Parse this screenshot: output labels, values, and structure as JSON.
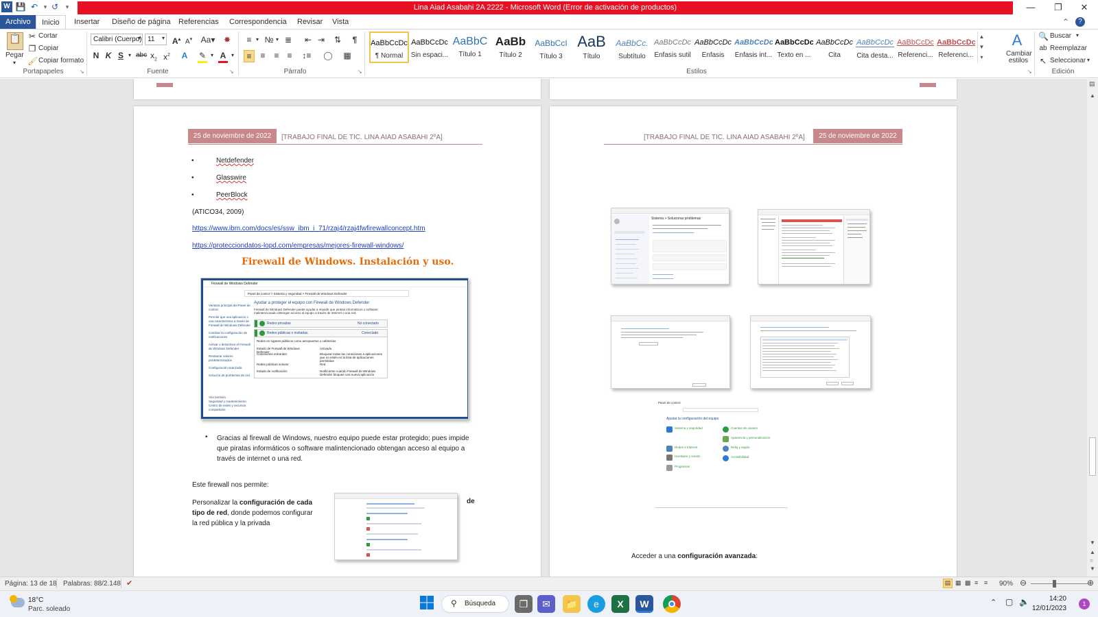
{
  "window": {
    "title": "Lina Aiad Asabahi 2A 2222  -  Microsoft Word (Error de activación de productos)"
  },
  "tabs": [
    "Archivo",
    "Inicio",
    "Insertar",
    "Diseño de página",
    "Referencias",
    "Correspondencia",
    "Revisar",
    "Vista"
  ],
  "ribbon": {
    "clipboard": {
      "paste": "Pegar",
      "cut": "Cortar",
      "copy": "Copiar",
      "format_painter": "Copiar formato",
      "group": "Portapapeles"
    },
    "font": {
      "name": "Calibri (Cuerpo)",
      "size": "11",
      "group": "Fuente"
    },
    "paragraph": {
      "group": "Párrafo"
    },
    "styles": {
      "group": "Estilos",
      "change_styles": "Cambiar estilos",
      "items": [
        {
          "sample": "AaBbCcDc",
          "name": "¶ Normal"
        },
        {
          "sample": "AaBbCcDc",
          "name": "Sin espaci..."
        },
        {
          "sample": "AaBbC",
          "name": "Título 1"
        },
        {
          "sample": "AaBb",
          "name": "Título 2"
        },
        {
          "sample": "AaBbCcI",
          "name": "Título 3"
        },
        {
          "sample": "AaB",
          "name": "Título"
        },
        {
          "sample": "AaBbCc.",
          "name": "Subtítulo"
        },
        {
          "sample": "AaBbCcDc",
          "name": "Énfasis sutil"
        },
        {
          "sample": "AaBbCcDc",
          "name": "Énfasis"
        },
        {
          "sample": "AaBbCcDc",
          "name": "Énfasis int..."
        },
        {
          "sample": "AaBbCcDc",
          "name": "Texto en ..."
        },
        {
          "sample": "AaBbCcDc",
          "name": "Cita"
        },
        {
          "sample": "AaBbCcDc",
          "name": "Cita desta..."
        },
        {
          "sample": "AaBbCcDc",
          "name": "Referenci..."
        },
        {
          "sample": "AaBbCcDc",
          "name": "Referenci..."
        }
      ]
    },
    "editing": {
      "find": "Buscar",
      "replace": "Reemplazar",
      "select": "Seleccionar",
      "group": "Edición"
    }
  },
  "left_page": {
    "header_date": "25 de noviembre de 2022",
    "header_title": "[TRABAJO FINAL DE TIC. LINA AIAD ASABAHI 2ºA]",
    "bullets": [
      "Netdefender",
      "Glasswire",
      "PeerBlock"
    ],
    "citation": "(ATICO34, 2009)",
    "link1": "https://www.ibm.com/docs/es/ssw_ibm_i_71/rzaj4/rzaj4fwfirewallconcept.htm",
    "link2": "https://protecciondatos-lopd.com/empresas/mejores-firewall-windows/",
    "heading": "Firewall de Windows. Instalación y uso.",
    "shot": {
      "window_title": "Firewall de Windows Defender",
      "breadcrumb": "Panel de control  >  Sistema y seguridad  >  Firewall de Windows Defender",
      "sidebar": [
        "Ventana principal del Panel de control",
        "Permitir que una aplicación o una característica a través de Firewall de Windows Defender",
        "Cambiar la configuración de notificaciones",
        "Activar o desactivar el Firewall de Windows Defender",
        "Restaurar valores predeterminados",
        "Configuración avanzada",
        "Solución de problemas de red"
      ],
      "see_also": [
        "Vea también",
        "Seguridad y mantenimiento",
        "Centro de redes y recursos compartidos"
      ],
      "heading": "Ayudar a proteger el equipo con Firewall de Windows Defender",
      "desc": "Firewall de Windows Defender puede ayudar a impedir que piratas informáticos o software malintencionado obtengan acceso al equipo a través de Internet o una red.",
      "private": "Redes privadas",
      "private_status": "No conectado",
      "public": "Redes públicas o invitadas",
      "public_status": "Conectado",
      "public_desc": "Redes en lugares públicos como aeropuertos o cafeterías",
      "rows": [
        [
          "Estado de Firewall de Windows Defender:",
          "Activado"
        ],
        [
          "Conexiones entrantes:",
          "Bloquear todas las conexiones a aplicaciones que no estén en la lista de aplicaciones permitidas"
        ],
        [
          "Redes públicas activas:",
          "Red"
        ],
        [
          "Estado de notificación:",
          "Notificarme cuando Firewall de Windows Defender bloquee una nueva aplicación"
        ]
      ]
    },
    "para1": "Gracias al firewall de Windows, nuestro equipo puede estar protegido; pues impide que piratas informáticos o software malintencionado obtengan acceso al equipo a través de internet o una red.",
    "para2": "Este firewall nos permite:",
    "para3_a": "Personalizar la ",
    "para3_b": "configuración de cada tipo de red",
    "para3_c": ", donde podemos configurar la red pública y la privada",
    "para3_de": "de"
  },
  "right_page": {
    "header_title": "[TRABAJO FINAL DE TIC. LINA AIAD ASABAHI 2ºA]",
    "header_date": "25 de noviembre de 2022",
    "shot1_title": "Sistema  >  Solucionar problemas",
    "shot6_title": "Panel de control",
    "shot6_heading": "Ajustar la configuración del equipo",
    "shot6_items": [
      "Sistema y seguridad",
      "Redes e Internet",
      "Hardware y sonido",
      "Programas",
      "Cuentas de usuario",
      "Apariencia y personalización",
      "Reloj y región",
      "Accesibilidad"
    ],
    "caption_a": "Acceder a una ",
    "caption_b": "configuración avanzada",
    "caption_c": ":"
  },
  "status": {
    "page": "Página: 13 de 18",
    "words": "Palabras: 88/2.148",
    "zoom": "90%"
  },
  "taskbar": {
    "weather_temp": "18°C",
    "weather_desc": "Parc. soleado",
    "search": "Búsqueda",
    "time": "14:20",
    "date": "12/01/2023"
  },
  "colors": {
    "word_blue": "#2b579a",
    "title_error": "#e81123",
    "header_rose": "#c8878a",
    "heading_orange": "#e46c0a",
    "link_blue": "#1f3dc4"
  }
}
